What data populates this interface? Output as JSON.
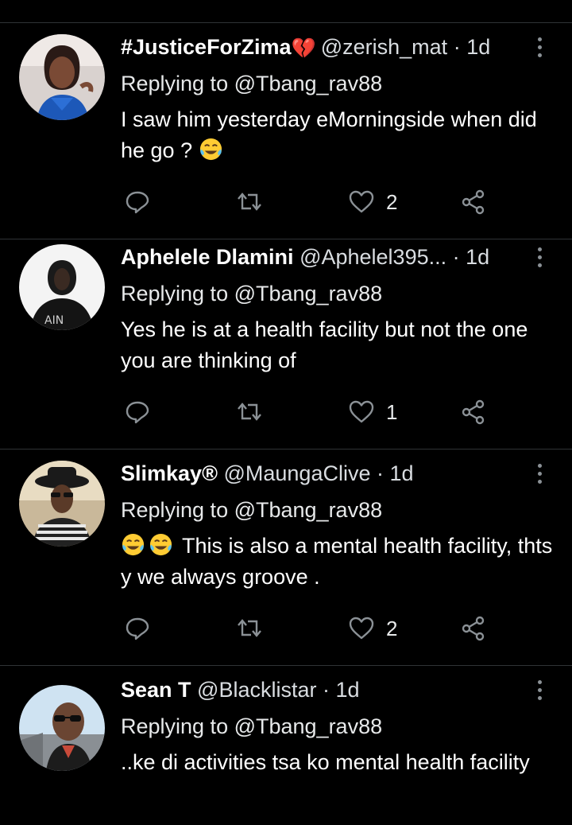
{
  "colors": {
    "background": "#000000",
    "text": "#e7e9ea",
    "secondary": "#8b9196",
    "divider": "#2f3336",
    "broken_heart": "#e0245e"
  },
  "icons": [
    "reply-icon",
    "retweet-icon",
    "like-icon",
    "share-icon",
    "more-options-icon",
    "broken-heart-emoji",
    "tears-of-joy-emoji"
  ],
  "replies": [
    {
      "name": "#JusticeForZima",
      "name_suffix_icon": "broken-heart-emoji",
      "handle": "@zerish_mat",
      "separator": "·",
      "time": "1d",
      "replying_to": "Replying to @Tbang_rav88",
      "text": "I saw him yesterday eMorningside when did he go ?",
      "text_suffix_emoji": "tears-of-joy-emoji",
      "likes": "2"
    },
    {
      "name": "Aphelele Dlamini",
      "handle": "@Aphelel395...",
      "separator": "·",
      "time": "1d",
      "replying_to": "Replying to @Tbang_rav88",
      "text": "Yes he is at a health facility but not the one you are thinking of",
      "likes": "1"
    },
    {
      "name": "Slimkay®⁡",
      "handle": "@MaungaClive",
      "separator": "·",
      "time": "1d",
      "replying_to": "Replying to @Tbang_rav88",
      "text_prefix_emoji": [
        "tears-of-joy-emoji",
        "tears-of-joy-emoji"
      ],
      "text": "This is also a  mental health facility, thts y we always groove .",
      "likes": "2"
    },
    {
      "name": "Sean T",
      "handle": "@Blacklistar",
      "separator": "·",
      "time": "1d",
      "replying_to": "Replying to @Tbang_rav88",
      "text": "..ke di activities tsa ko mental health facility"
    }
  ]
}
